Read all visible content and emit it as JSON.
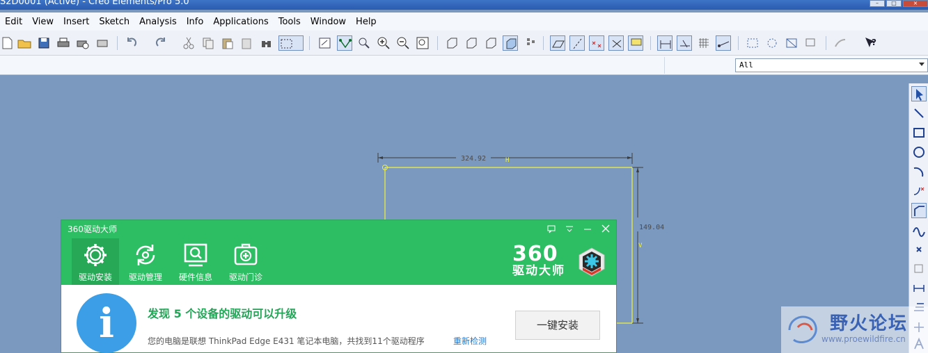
{
  "window": {
    "title": "S2D0001 (Active) - Creo Elements/Pro 5.0"
  },
  "menu": [
    "Edit",
    "View",
    "Insert",
    "Sketch",
    "Analysis",
    "Info",
    "Applications",
    "Tools",
    "Window",
    "Help"
  ],
  "filter": {
    "value": "All"
  },
  "sketch": {
    "dim_horizontal": "324.92",
    "dim_vertical": "149.04",
    "label_h": "H",
    "label_v": "V"
  },
  "dialog": {
    "title": "360驱动大师",
    "tabs": [
      "驱动安装",
      "驱动管理",
      "硬件信息",
      "驱动门诊"
    ],
    "brand_big": "360",
    "brand_small": "驱动大师",
    "headline": "发现 5 个设备的驱动可以升级",
    "subline": "您的电脑是联想 ThinkPad Edge E431 笔记本电脑，共找到11个驱动程序",
    "recheck": "重新检测",
    "install_button": "一键安装"
  },
  "watermark": {
    "title": "野火论坛",
    "url": "www.proewildfire.cn"
  },
  "colors": {
    "canvas": "#7b99bf",
    "sketch_line": "#f2f23c",
    "dialog_green": "#2dbd62",
    "info_blue": "#3c9ee6",
    "link_blue": "#1a78d4"
  }
}
